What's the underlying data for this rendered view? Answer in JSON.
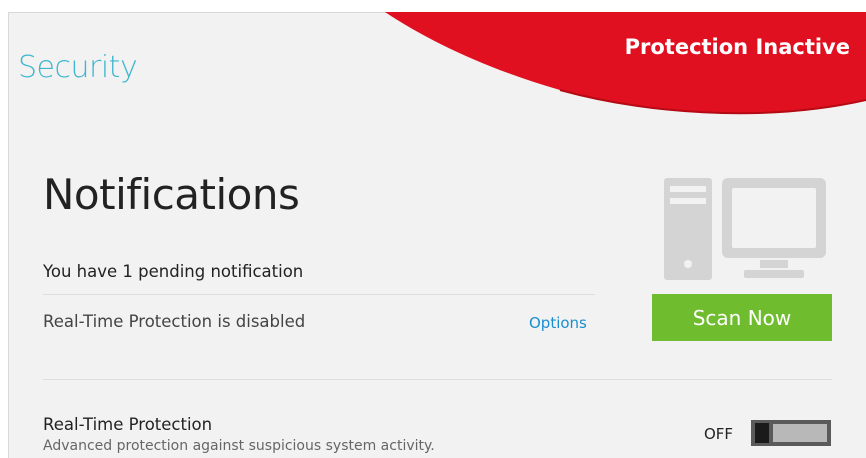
{
  "header": {
    "app_title": "Security",
    "status_banner": "Protection Inactive"
  },
  "notifications": {
    "heading": "Notifications",
    "pending_text": "You have 1 pending notification",
    "items": [
      {
        "message": "Real-Time Protection is disabled",
        "action_label": "Options"
      }
    ]
  },
  "actions": {
    "scan_label": "Scan Now"
  },
  "realtime_protection": {
    "title": "Real-Time Protection",
    "description": "Advanced protection against suspicious system activity.",
    "toggle_label": "OFF",
    "enabled": false
  },
  "colors": {
    "banner_red": "#e01020",
    "accent_cyan": "#3fb6cf",
    "scan_green": "#6fbd2e",
    "link_blue": "#1a8ed0",
    "icon_gray": "#d4d4d4"
  }
}
